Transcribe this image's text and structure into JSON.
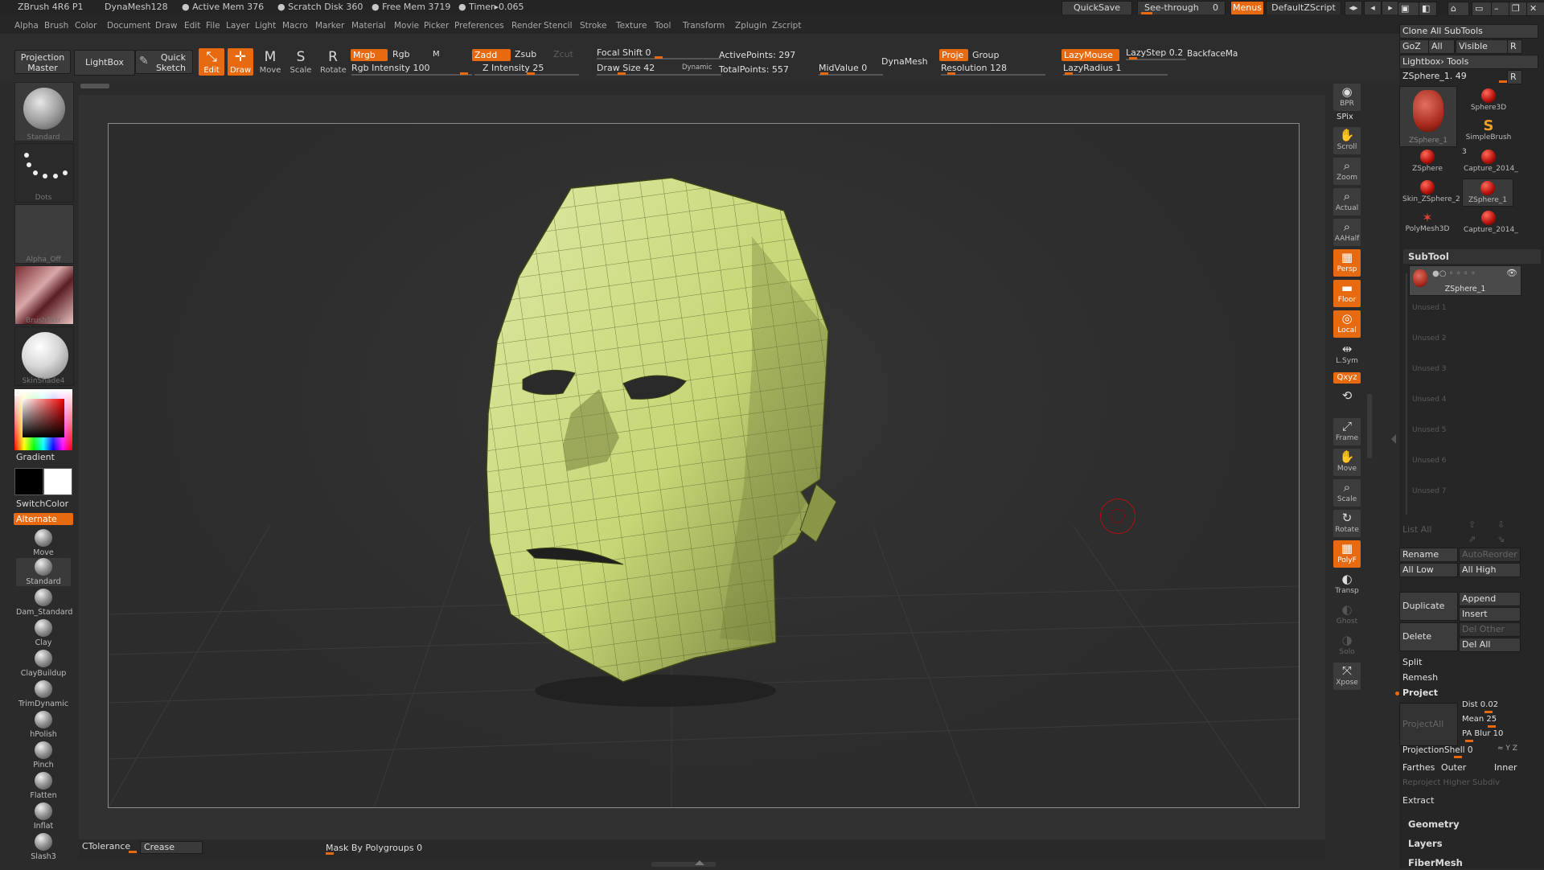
{
  "titlebar": {
    "app": "ZBrush 4R6 P1",
    "doc": "DynaMesh128",
    "active_mem": "● Active Mem 376",
    "scratch_disk": "● Scratch Disk 360",
    "free_mem": "● Free Mem 3719",
    "timer": "● Timer▸0.065",
    "quicksave": "QuickSave",
    "see_through": "See-through",
    "see_through_value": "0",
    "menus": "Menus",
    "default_zscript": "DefaultZScript"
  },
  "menubar": [
    "Alpha",
    "Brush",
    "Color",
    "Document",
    "Draw",
    "Edit",
    "File",
    "Layer",
    "Light",
    "Macro",
    "Marker",
    "Material",
    "Movie",
    "Picker",
    "Preferences",
    "Render",
    "Stencil",
    "Stroke",
    "Texture",
    "Tool",
    "Transform",
    "Zplugin",
    "Zscript"
  ],
  "toolbar": {
    "projection_master_1": "Projection",
    "projection_master_2": "Master",
    "lightbox": "LightBox",
    "quick_sketch_1": "Quick",
    "quick_sketch_2": "Sketch",
    "edit": "Edit",
    "draw": "Draw",
    "move": "Move",
    "scale": "Scale",
    "rotate": "Rotate",
    "mrgb": "Mrgb",
    "rgb": "Rgb",
    "m": "M",
    "rgb_intensity": "Rgb Intensity 100",
    "zadd": "Zadd",
    "zsub": "Zsub",
    "zcut": "Zcut",
    "z_intensity": "Z Intensity 25",
    "focal_shift": "Focal Shift 0",
    "draw_size": "Draw Size 42",
    "dynamic": "Dynamic",
    "active_points": "ActivePoints: 297",
    "total_points": "TotalPoints: 557",
    "midvalue": "MidValue 0",
    "dynamesh": "DynaMesh",
    "proje": "Proje",
    "group": "Group",
    "resolution": "Resolution 128",
    "lazymouse": "LazyMouse",
    "lazystep": "LazyStep 0.2",
    "backface": "BackfaceMa",
    "lazyradius": "LazyRadius 1"
  },
  "leftshelf": {
    "standard_label": "Standard",
    "dots_label": "Dots",
    "alpha_label": "Alpha_Off",
    "texture_label": "BrushTxtr",
    "material_label": "SkinShade4",
    "gradient": "Gradient",
    "switchcolor": "SwitchColor",
    "alternate": "Alternate",
    "brushes": [
      "Move",
      "Standard",
      "Dam_Standard",
      "Clay",
      "ClayBuildup",
      "TrimDynamic",
      "hPolish",
      "Pinch",
      "Flatten",
      "Inflat",
      "Slash3"
    ]
  },
  "rightshelf": [
    {
      "label": "BPR",
      "glyph": "◉",
      "state": "normal"
    },
    {
      "label": "SPix",
      "glyph": "",
      "state": "text"
    },
    {
      "label": "Scroll",
      "glyph": "✋",
      "state": "normal"
    },
    {
      "label": "Zoom",
      "glyph": "🔍",
      "state": "normal"
    },
    {
      "label": "Actual",
      "glyph": "🔍",
      "state": "normal"
    },
    {
      "label": "AAHalf",
      "glyph": "🔍",
      "state": "normal"
    },
    {
      "label": "Persp",
      "glyph": "▦",
      "state": "orange"
    },
    {
      "label": "Floor",
      "glyph": "▬",
      "state": "orange"
    },
    {
      "label": "Local",
      "glyph": "◎",
      "state": "orange"
    },
    {
      "label": "L.Sym",
      "glyph": "⇹",
      "state": "normal"
    },
    {
      "label": "Qxyz",
      "glyph": "",
      "state": "orange-small"
    },
    {
      "label": "",
      "glyph": "⟲",
      "state": "normal"
    },
    {
      "label": "Frame",
      "glyph": "⤢",
      "state": "normal"
    },
    {
      "label": "Move",
      "glyph": "✋",
      "state": "normal"
    },
    {
      "label": "Scale",
      "glyph": "🔍",
      "state": "normal"
    },
    {
      "label": "Rotate",
      "glyph": "↻",
      "state": "normal"
    },
    {
      "label": "PolyF",
      "glyph": "▦",
      "state": "orange"
    },
    {
      "label": "Transp",
      "glyph": "◐",
      "state": "normal"
    },
    {
      "label": "Ghost",
      "glyph": "◐",
      "state": "dim"
    },
    {
      "label": "Solo",
      "glyph": "◑",
      "state": "dim"
    },
    {
      "label": "Xpose",
      "glyph": "⤧",
      "state": "normal"
    }
  ],
  "rightpanel": {
    "clone_all": "Clone  All SubTools",
    "goz": "GoZ",
    "all": "All",
    "visible": "Visible",
    "r": "R",
    "lightbox_tools": "Lightbox› Tools",
    "current_tool": "ZSphere_1. 49",
    "tools": [
      {
        "label": "ZSphere_1",
        "kind": "head-sel"
      },
      {
        "label": "Sphere3D",
        "kind": "ball"
      },
      {
        "label": "SimpleBrush",
        "kind": "s"
      },
      {
        "label": "ZSphere",
        "kind": "ball"
      },
      {
        "label": "Capture_2014_",
        "kind": "head"
      },
      {
        "label": "Skin_ZSphere_2",
        "kind": "head"
      },
      {
        "label": "ZSphere_1",
        "kind": "head-sel"
      },
      {
        "label": "PolyMesh3D",
        "kind": "star"
      },
      {
        "label": "Capture_2014_",
        "kind": "head"
      }
    ],
    "tool_count": "3",
    "subtool_header": "SubTool",
    "subtool_active": "ZSphere_1",
    "unused": [
      "Unused 1",
      "Unused 2",
      "Unused 3",
      "Unused 4",
      "Unused 5",
      "Unused 6",
      "Unused 7"
    ],
    "list_all": "List  All",
    "rename": "Rename",
    "autoreorder": "AutoReorder",
    "all_low": "All Low",
    "all_high": "All High",
    "duplicate": "Duplicate",
    "append": "Append",
    "insert": "Insert",
    "delete": "Delete",
    "del_other": "Del Other",
    "del_all": "Del All",
    "split": "Split",
    "remesh": "Remesh",
    "project": "Project",
    "project_all": "ProjectAll",
    "dist": "Dist 0.02",
    "mean": "Mean 25",
    "pa_blur": "PA Blur 10",
    "projection_shell": "ProjectionShell 0",
    "farthest": "Farthes",
    "outer": "Outer",
    "inner": "Inner",
    "reproject": "Reproject Higher Subdiv",
    "extract": "Extract",
    "geometry": "Geometry",
    "layers": "Layers",
    "fibermesh": "FiberMesh"
  },
  "bottombar": {
    "ctolerance": "CTolerance",
    "crease": "Crease",
    "mask_by_polygroups": "Mask By Polygroups 0"
  },
  "colors": {
    "accent": "#e86a10",
    "mesh": "#cfdc7e",
    "panel": "#262626"
  }
}
